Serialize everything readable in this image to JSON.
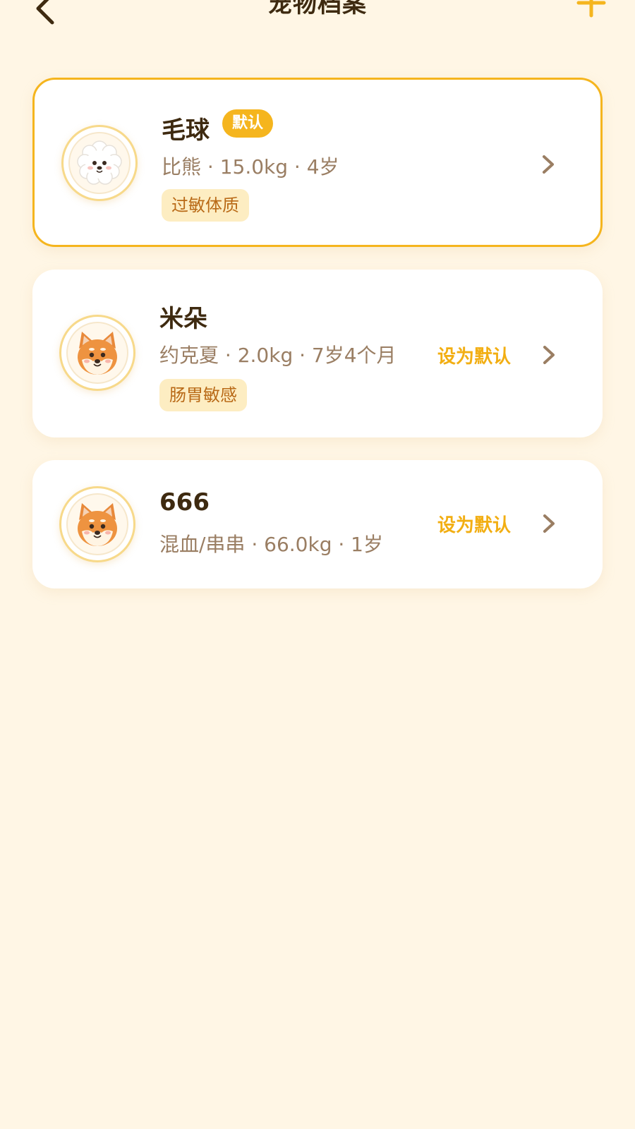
{
  "header": {
    "title": "宠物档案",
    "back_icon": "chevron-left-icon",
    "add_icon": "plus-icon"
  },
  "colors": {
    "accent": "#F5B51E",
    "background": "#FFF6E5",
    "text": "#3E2A10",
    "muted_text": "#9A7E63",
    "tag_bg": "#FDEDC2",
    "tag_text": "#B96A17"
  },
  "pets": [
    {
      "name": "毛球",
      "badge": "默认",
      "info": "比熊 · 15.0kg · 4岁",
      "tag": "过敏体质",
      "avatar": "bichon-avatar",
      "is_default": true
    },
    {
      "name": "米朵",
      "info": "约克夏 · 2.0kg · 7岁4个月",
      "tag": "肠胃敏感",
      "action": "设为默认",
      "avatar": "shiba-avatar",
      "is_default": false
    },
    {
      "name": "666",
      "info": "混血/串串 · 66.0kg · 1岁",
      "action": "设为默认",
      "avatar": "shiba-avatar",
      "is_default": false
    }
  ]
}
